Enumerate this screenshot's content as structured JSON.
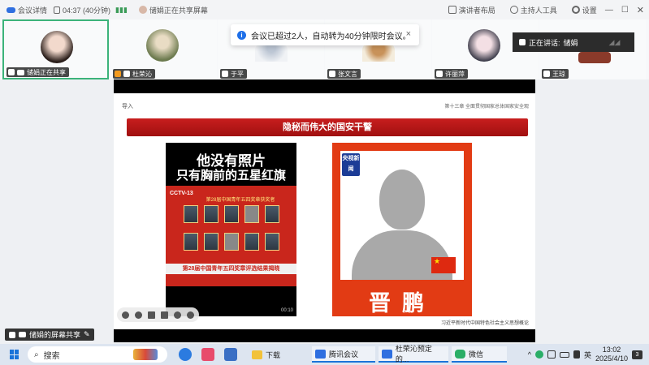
{
  "topbar": {
    "meeting_details": "会议详情",
    "timer": "04:37 (40分钟)",
    "sharing_status": "储娟正在共享屏幕",
    "layout": "演讲者布局",
    "host_tools": "主持人工具",
    "settings": "设置"
  },
  "participants": [
    {
      "name": "储娟正在共享",
      "mic": "on",
      "active": true,
      "avatar_color": "#d8b8a8"
    },
    {
      "name": "杜荣沁",
      "mic": "orange",
      "active": false,
      "avatar_color": "#9fb08a"
    },
    {
      "name": "于平",
      "mic": "on",
      "active": false,
      "avatar_color": "#c9d1dc"
    },
    {
      "name": "张文言",
      "mic": "muted",
      "active": false,
      "avatar_color": "#d8b27a"
    },
    {
      "name": "许丽萍",
      "mic": "on",
      "active": false,
      "avatar_color": "#e6d0d8"
    },
    {
      "name": "王琼",
      "mic": "on",
      "active": false,
      "avatar_color": "#8a3a2a"
    }
  ],
  "toast": {
    "message": "会议已超过2人，自动转为40分钟限时会议。",
    "close": "×"
  },
  "speaking": {
    "label": "正在讲话:",
    "name": "储娟"
  },
  "slide": {
    "head_left": "导入",
    "head_right": "第十三章  全面贯彻国家总体国家安全观",
    "banner": "隐秘而伟大的国安干警",
    "left_poster": {
      "line1": "他没有照片",
      "line2": "只有胸前的五星红旗",
      "channel": "CCTV-13",
      "award_top": "第28届中国青年五四奖章获奖者",
      "award_bar": "第28届中国青年五四奖章评选结果揭晓",
      "corner": "00:10"
    },
    "right_poster": {
      "badge": "央视新闻",
      "name": "晋鹏"
    },
    "footnote": "习近平新时代中国特色社会主义思想概论"
  },
  "share_badge": "储娟的屏幕共享",
  "taskbar": {
    "search": "搜索",
    "apps": [
      {
        "label": "下载"
      },
      {
        "label": "腾讯会议"
      },
      {
        "label": "杜荣沁预定的..."
      },
      {
        "label": "微信"
      }
    ],
    "ime": "英",
    "time": "13:02",
    "date": "2025/4/10",
    "notifications": "3"
  }
}
